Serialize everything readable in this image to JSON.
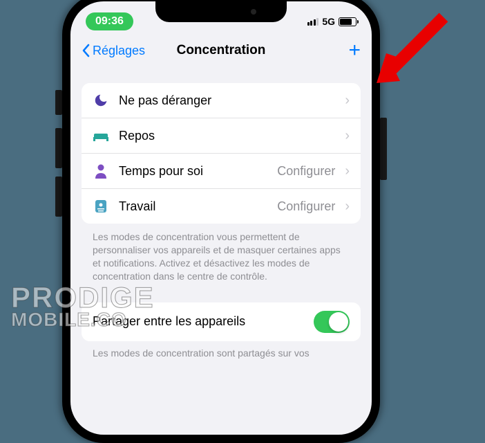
{
  "status": {
    "time": "09:36",
    "network": "5G"
  },
  "nav": {
    "back": "Réglages",
    "title": "Concentration",
    "add": "+"
  },
  "modes": [
    {
      "icon": "moon",
      "color": "#4f3da8",
      "label": "Ne pas déranger",
      "side": ""
    },
    {
      "icon": "bed",
      "color": "#26a69a",
      "label": "Repos",
      "side": ""
    },
    {
      "icon": "person",
      "color": "#7d4ec2",
      "label": "Temps pour soi",
      "side": "Configurer"
    },
    {
      "icon": "badge",
      "color": "#4aa3c2",
      "label": "Travail",
      "side": "Configurer"
    }
  ],
  "footer": "Les modes de concentration vous permettent de personnaliser vos appareils et de masquer certaines apps et notifications. Activez et désactivez les modes de concentration dans le centre de contrôle.",
  "share": {
    "label": "Partager entre les appareils",
    "on": true
  },
  "footer2": "Les modes de concentration sont partagés sur vos",
  "watermark": {
    "line1": "PRODIGE",
    "line2": "MOBILE.CO"
  }
}
